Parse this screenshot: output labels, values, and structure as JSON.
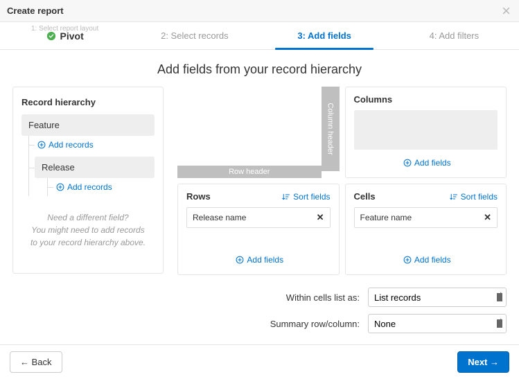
{
  "header": {
    "title": "Create report"
  },
  "steps": {
    "s1_sublabel": "1: Select report layout",
    "s1_label": "Pivot",
    "s2": "2: Select records",
    "s3": "3: Add fields",
    "s4": "4: Add filters"
  },
  "page_title": "Add fields from your record hierarchy",
  "hierarchy": {
    "heading": "Record hierarchy",
    "item1": "Feature",
    "add1": "Add records",
    "item2": "Release",
    "add2": "Add records",
    "hint_line1": "Need a different field?",
    "hint_line2": "You might need to add records",
    "hint_line3": "to your record hierarchy above."
  },
  "preview": {
    "col_header": "Column header",
    "row_header": "Row header"
  },
  "columns": {
    "title": "Columns",
    "add": "Add fields"
  },
  "rows": {
    "title": "Rows",
    "sort": "Sort fields",
    "chip": "Release name",
    "add": "Add fields"
  },
  "cells": {
    "title": "Cells",
    "sort": "Sort fields",
    "chip": "Feature name",
    "add": "Add fields"
  },
  "options": {
    "within_label": "Within cells list as:",
    "within_value": "List records",
    "summary_label": "Summary row/column:",
    "summary_value": "None"
  },
  "footer": {
    "back": "← Back",
    "next": "Next →"
  }
}
